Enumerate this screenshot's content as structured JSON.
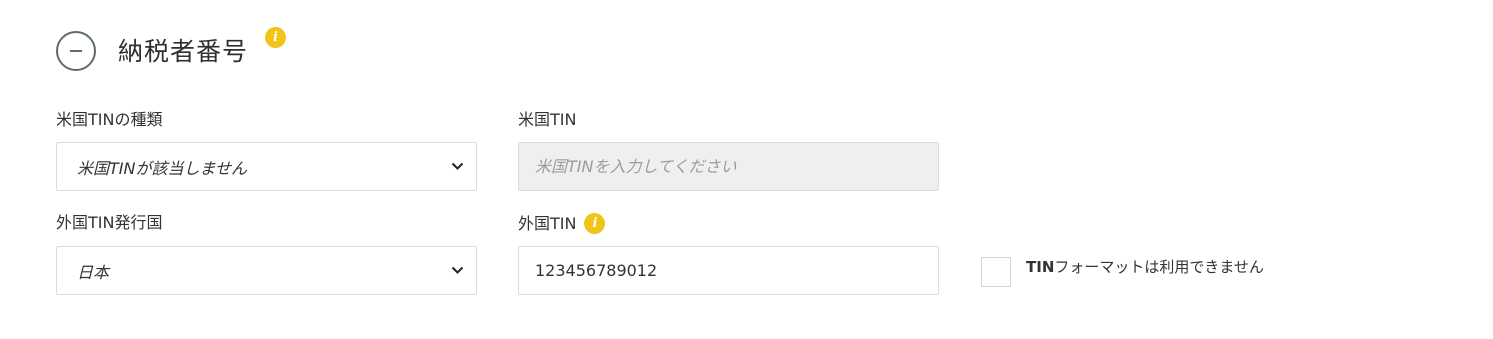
{
  "section": {
    "title": "納税者番号",
    "info_glyph": "i"
  },
  "fields": {
    "us_tin_type": {
      "label": "米国TINの種類",
      "value": "米国TINが該当しません"
    },
    "us_tin": {
      "label": "米国TIN",
      "placeholder": "米国TINを入力してください"
    },
    "foreign_tin_country": {
      "label": "外国TIN発行国",
      "value": "日本"
    },
    "foreign_tin": {
      "label": "外国TIN",
      "value": "123456789012",
      "info_glyph": "i"
    }
  },
  "tin_format_checkbox": {
    "label_bold": "TIN",
    "label_rest": "フォーマットは利用できません",
    "checked": false
  },
  "colors": {
    "info_icon": "#f0c419",
    "collapse_icon": "#5f6b6a",
    "disabled_input_bg": "#efefef",
    "border": "#dcdcdc"
  },
  "icons": {
    "collapse": "minus-circle-icon",
    "info": "info-icon",
    "dropdown": "chevron-down-icon"
  }
}
